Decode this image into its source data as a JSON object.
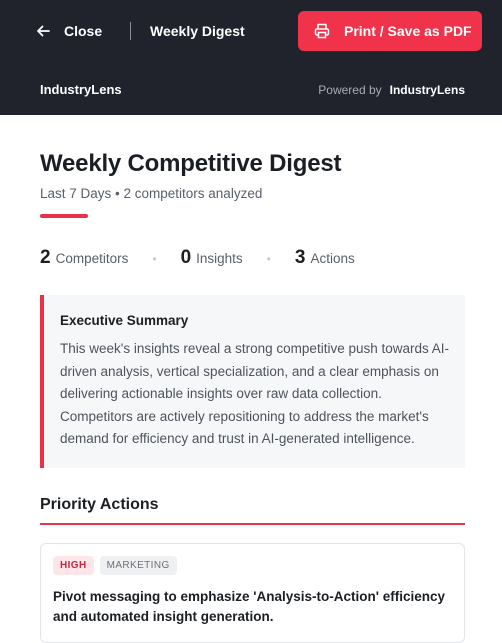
{
  "header": {
    "close_label": "Close",
    "doc_title": "Weekly Digest",
    "print_label": "Print / Save as PDF",
    "brand": "IndustryLens",
    "powered_prefix": "Powered by",
    "powered_brand": "IndustryLens"
  },
  "report": {
    "title": "Weekly Competitive Digest",
    "subtitle": "Last 7 Days • 2 competitors analyzed",
    "stats": [
      {
        "value": "2",
        "label": "Competitors"
      },
      {
        "value": "0",
        "label": "Insights"
      },
      {
        "value": "3",
        "label": "Actions"
      }
    ],
    "summary": {
      "title": "Executive Summary",
      "body": "This week's insights reveal a strong competitive push towards AI-driven analysis, vertical specialization, and a clear emphasis on delivering actionable insights over raw data collection. Competitors are actively repositioning to address the market's demand for efficiency and trust in AI-generated intelligence."
    },
    "priority_actions": {
      "title": "Priority Actions",
      "items": [
        {
          "priority": "HIGH",
          "category": "MARKETING",
          "text": "Pivot messaging to emphasize 'Analysis-to-Action' efficiency and automated insight generation."
        }
      ]
    }
  },
  "colors": {
    "accent": "#e8314a",
    "header_bg": "#20232b",
    "button": "#f0334b"
  },
  "icons": {
    "close": "arrow-left-icon",
    "print": "printer-icon"
  }
}
